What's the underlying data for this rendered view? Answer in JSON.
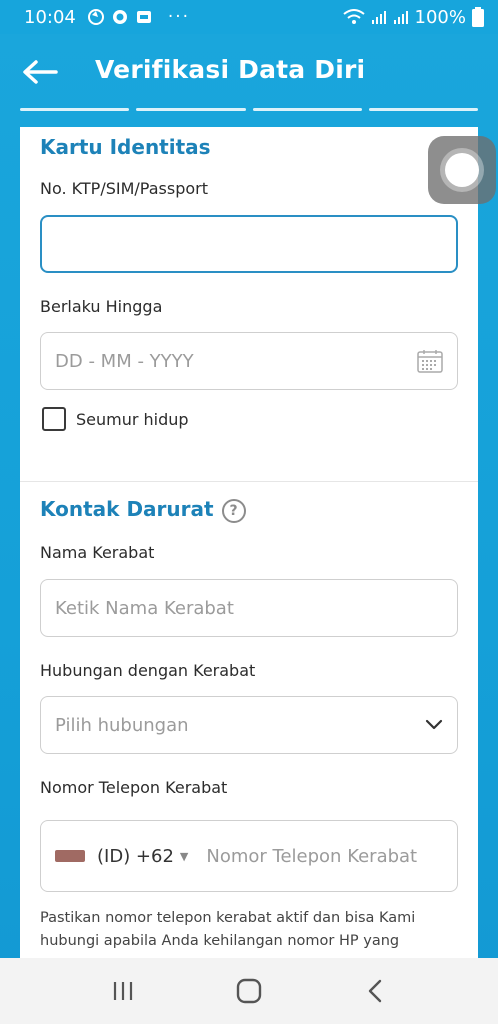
{
  "status_bar": {
    "time": "10:04",
    "overflow_dots": "···",
    "battery": "100%"
  },
  "header": {
    "title": "Verifikasi Data Diri",
    "progress_steps": 4
  },
  "identity": {
    "section_title": "Kartu Identitas",
    "id_label": "No. KTP/SIM/Passport",
    "id_value": "",
    "valid_until_label": "Berlaku Hingga",
    "valid_until_placeholder": "DD - MM - YYYY",
    "lifetime_label": "Seumur hidup",
    "lifetime_checked": false
  },
  "emergency": {
    "section_title": "Kontak Darurat",
    "help_symbol": "?",
    "name_label": "Nama Kerabat",
    "name_placeholder": "Ketik Nama Kerabat",
    "relation_label": "Hubungan dengan Kerabat",
    "relation_placeholder": "Pilih hubungan",
    "phone_label": "Nomor Telepon Kerabat",
    "country_code": "(ID) +62",
    "phone_placeholder": "Nomor Telepon Kerabat",
    "note": "Pastikan nomor telepon kerabat aktif dan bisa Kami hubungi apabila Anda kehilangan nomor HP yang"
  },
  "colors": {
    "primary": "#1aa6dc",
    "section_title": "#1d82b8",
    "active_border": "#2a8fc4"
  },
  "icons": [
    "back-arrow-icon",
    "calendar-icon",
    "help-icon",
    "chevron-down-icon",
    "recent-apps-icon",
    "home-icon",
    "nav-back-icon"
  ]
}
